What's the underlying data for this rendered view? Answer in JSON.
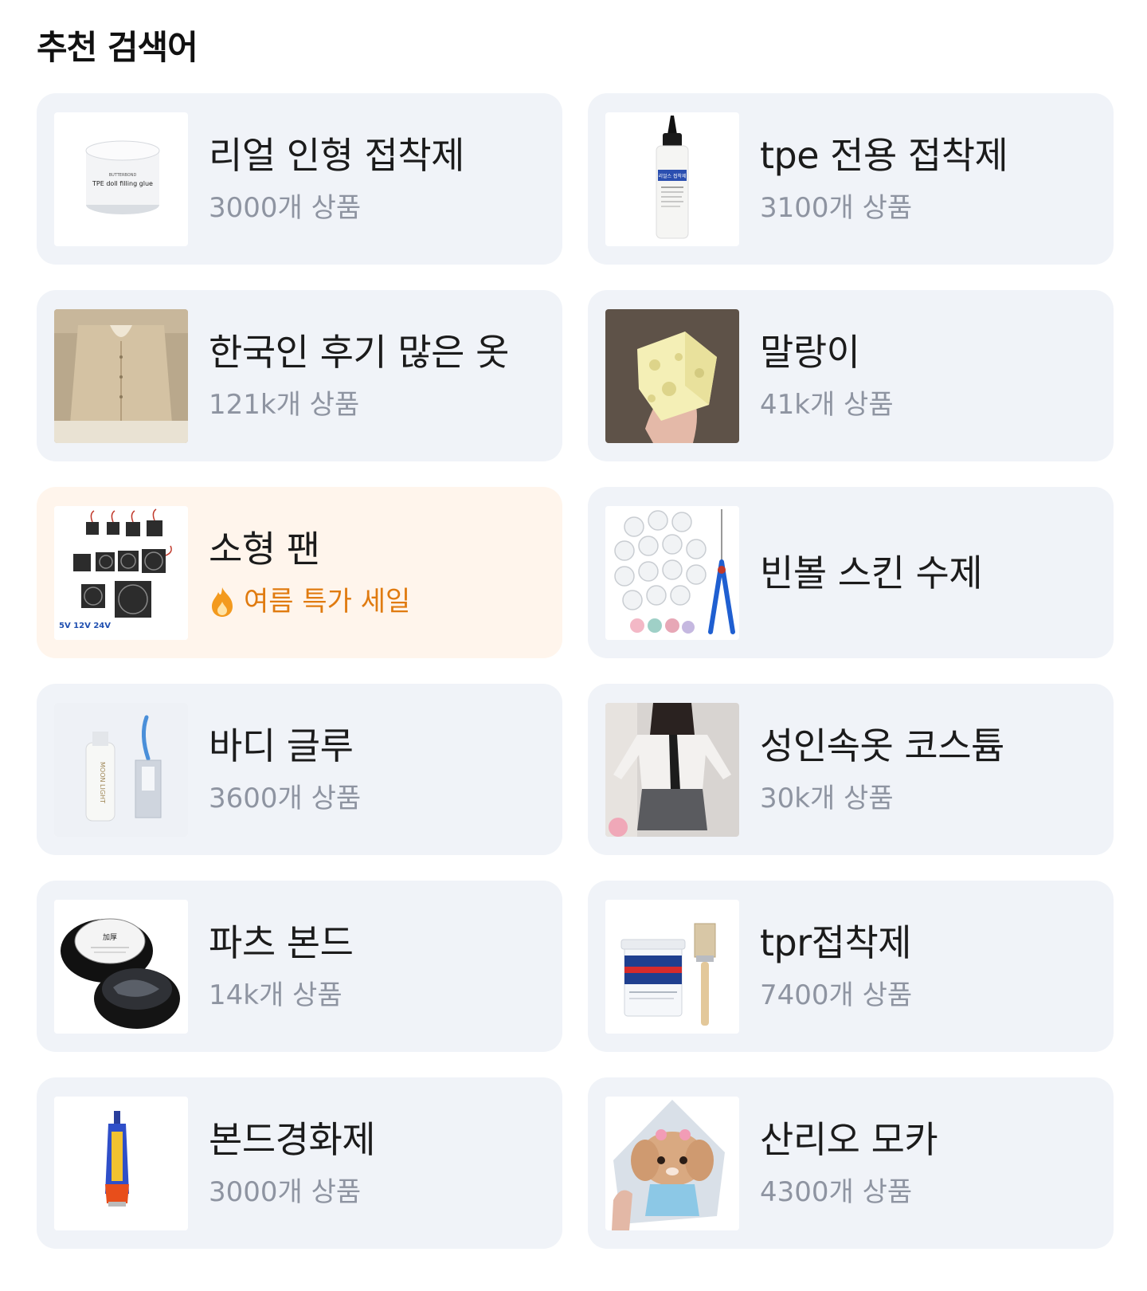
{
  "section": {
    "title": "추천 검색어"
  },
  "items": [
    {
      "keyword": "리얼 인형 접착제",
      "sub": "3000개 상품",
      "thumb": "glue-tub-image",
      "thumb_text": [
        "TPE doll filling glue",
        "BUTTERBOND"
      ]
    },
    {
      "keyword": "tpe 전용 접착제",
      "sub": "3100개 상품",
      "thumb": "glue-bottle-image",
      "thumb_text": [
        "리얼스 접착제"
      ]
    },
    {
      "keyword": "한국인 후기 많은 옷",
      "sub": "121k개 상품",
      "thumb": "cardigan-image"
    },
    {
      "keyword": "말랑이",
      "sub": "41k개 상품",
      "thumb": "squishy-cube-image"
    },
    {
      "keyword": "소형 팬",
      "sub": "여름 특가 세일",
      "promo": true,
      "thumb": "small-fans-image",
      "thumb_text": [
        "5V 12V 24V"
      ]
    },
    {
      "keyword": "빈볼 스킨 수제",
      "sub": "",
      "thumb": "bean-ball-kit-image"
    },
    {
      "keyword": "바디 글루",
      "sub": "3600개 상품",
      "thumb": "body-glue-image",
      "thumb_text": [
        "MOON LIGHT"
      ]
    },
    {
      "keyword": "성인속옷 코스튬",
      "sub": "30k개 상품",
      "thumb": "costume-image"
    },
    {
      "keyword": "파츠 본드",
      "sub": "14k개 상품",
      "thumb": "parts-bond-jars-image",
      "thumb_text": [
        "加厚"
      ]
    },
    {
      "keyword": "tpr접착제",
      "sub": "7400개 상품",
      "thumb": "tpr-glue-bucket-image"
    },
    {
      "keyword": "본드경화제",
      "sub": "3000개 상품",
      "thumb": "bond-tube-image"
    },
    {
      "keyword": "산리오 모카",
      "sub": "4300개 상품",
      "thumb": "sanrio-plush-image"
    }
  ],
  "colors": {
    "card_bg": "#f0f3f8",
    "promo_bg": "#fff5ec",
    "promo_text": "#e07b10",
    "sub_text": "#8e94a1"
  }
}
